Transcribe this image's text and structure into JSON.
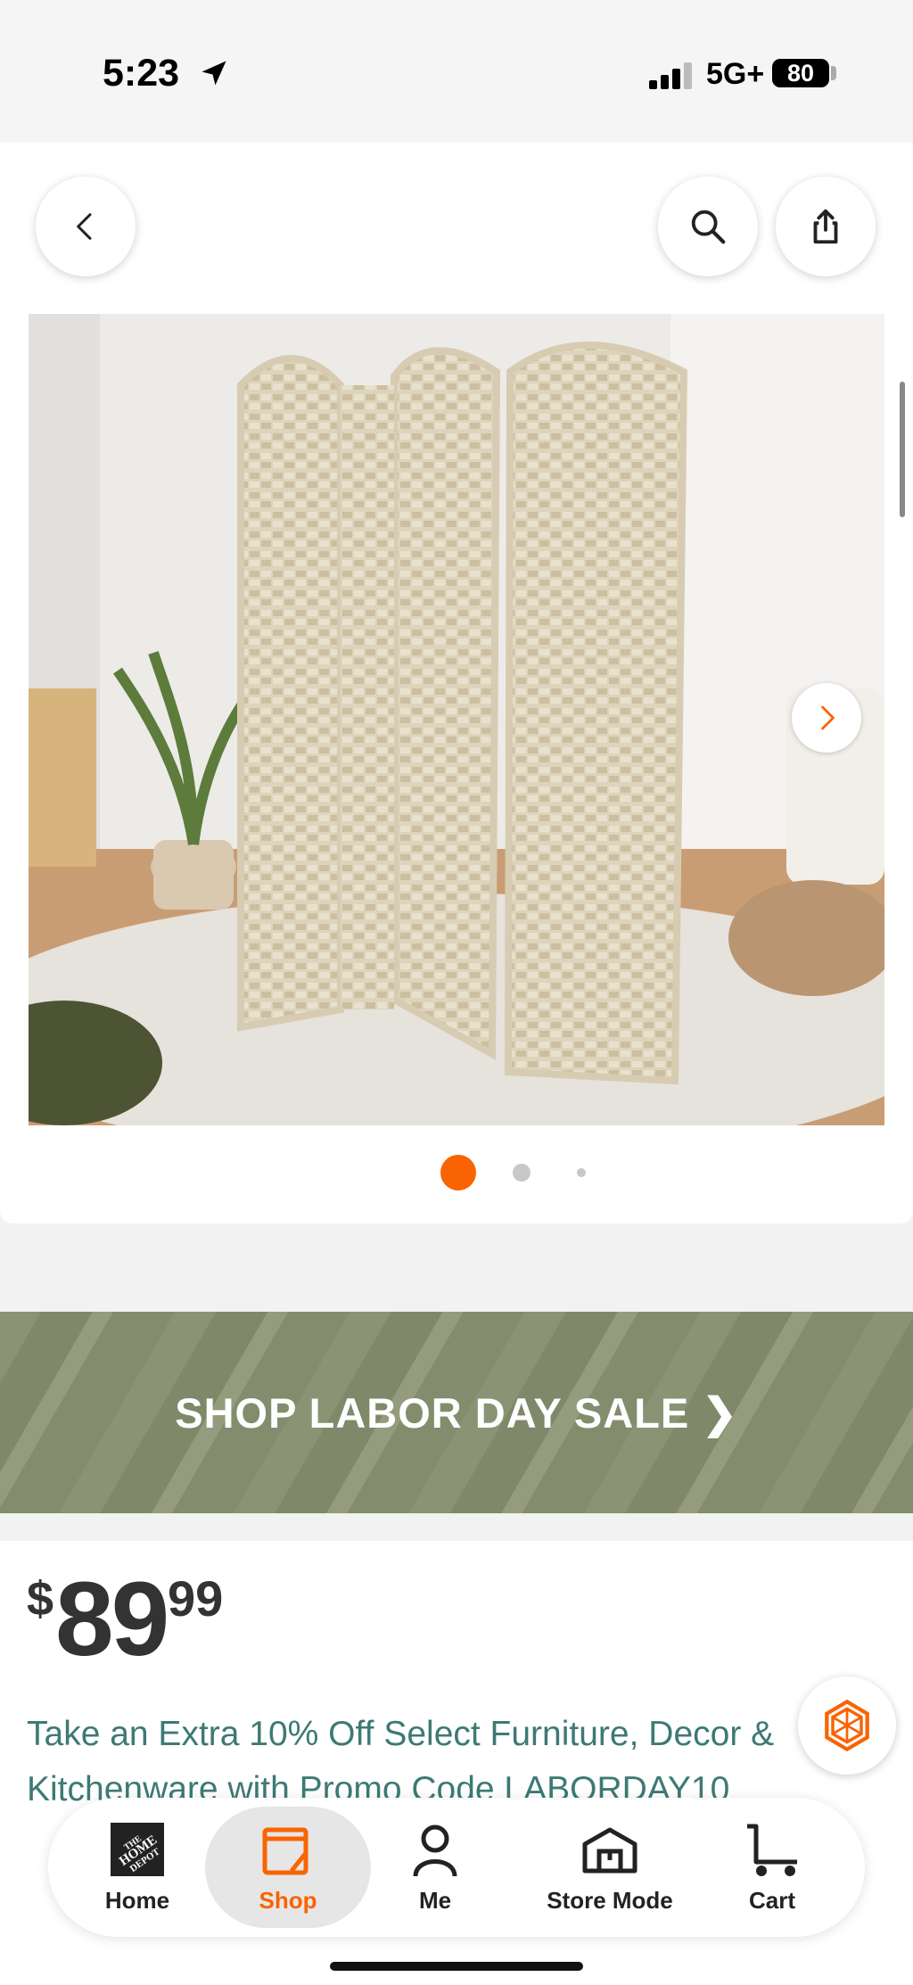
{
  "status_bar": {
    "time": "5:23",
    "network": "5G+",
    "battery": "80"
  },
  "gallery": {
    "current_index": 1,
    "total": 3
  },
  "banner": {
    "text": "SHOP LABOR DAY SALE ❯"
  },
  "product": {
    "price_symbol": "$",
    "price_dollars": "89",
    "price_cents": "99",
    "promo_line_1": "Take an Extra 10% Off Select Furniture, Decor &",
    "promo_line_2": "Kitchenware with Promo Code LABORDAY10"
  },
  "tabs": [
    {
      "label": "Home",
      "icon": "home-depot-logo-icon"
    },
    {
      "label": "Shop",
      "icon": "shop-icon",
      "active": true
    },
    {
      "label": "Me",
      "icon": "person-icon"
    },
    {
      "label": "Store Mode",
      "icon": "store-icon"
    },
    {
      "label": "Cart",
      "icon": "cart-icon"
    }
  ],
  "colors": {
    "accent": "#f96302",
    "promo_text": "#3d7a74",
    "banner": "#8a9373"
  }
}
